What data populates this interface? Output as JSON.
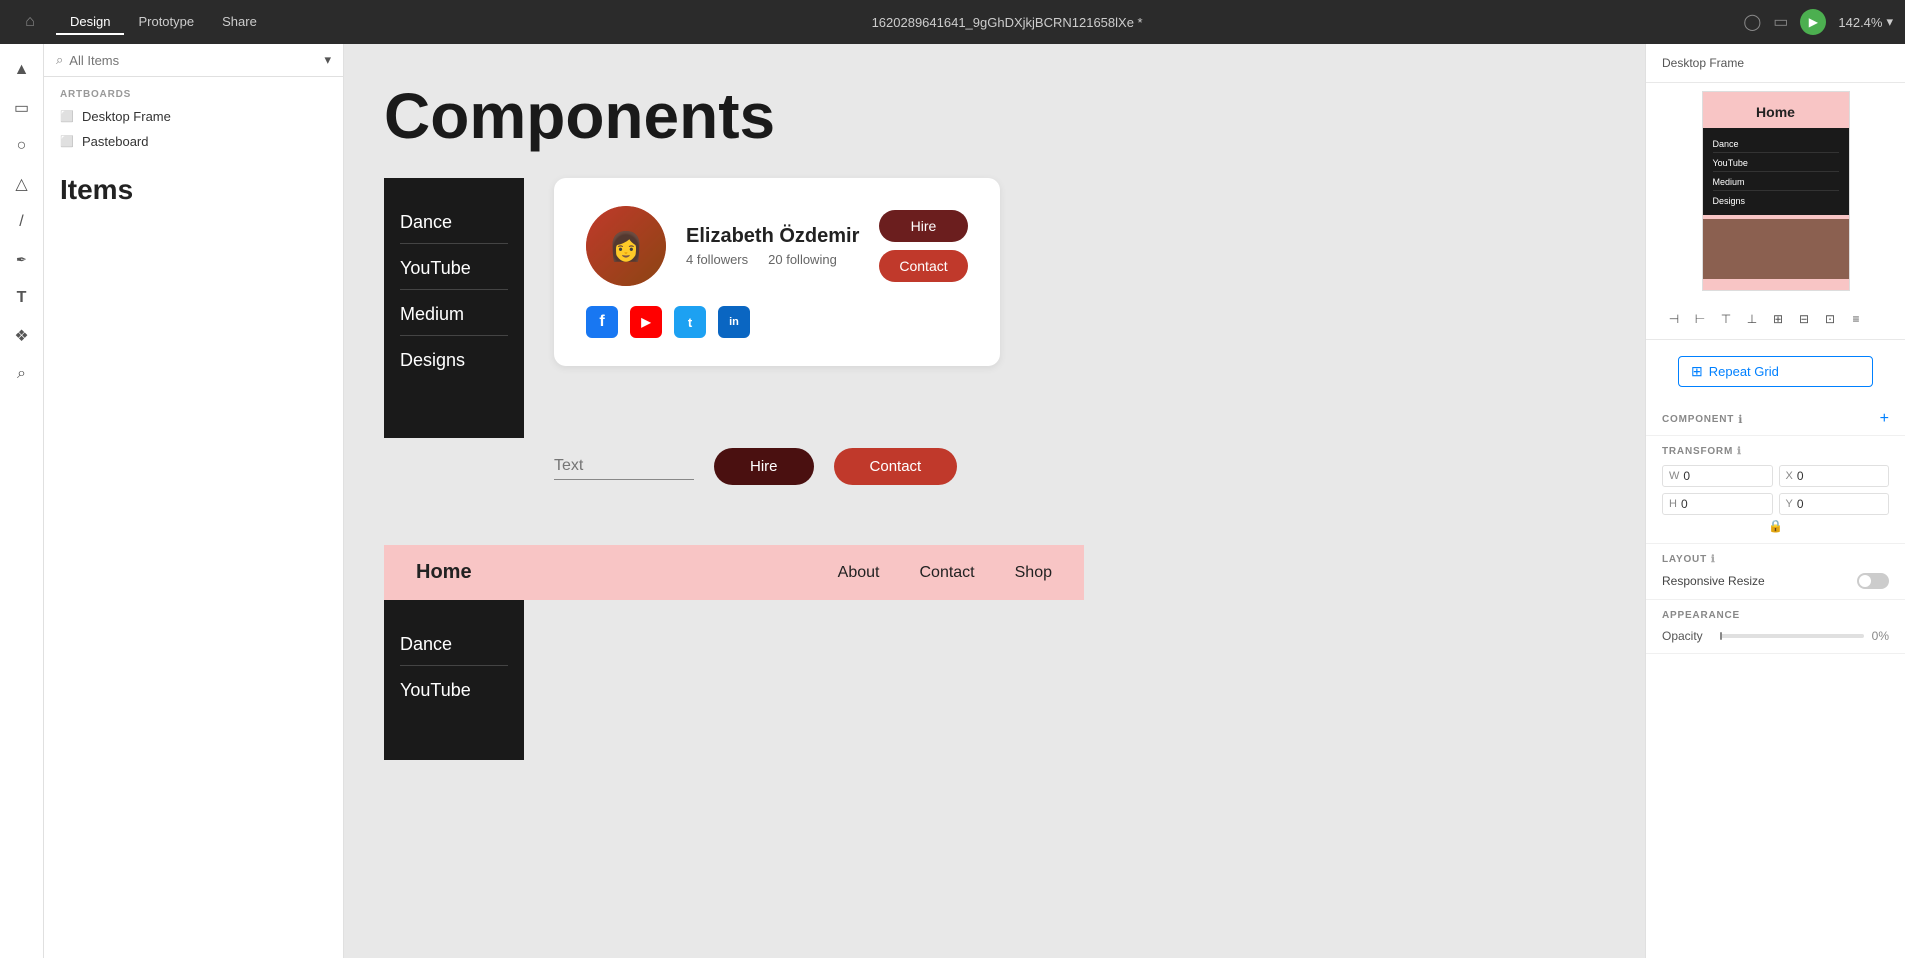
{
  "topbar": {
    "home_icon": "⌂",
    "tabs": [
      "Design",
      "Prototype",
      "Share"
    ],
    "active_tab": "Design",
    "filename": "1620289641641_9gGhDXjkjBCRN121658lXe *",
    "zoom": "142.4%",
    "play_icon": "▶",
    "device_icon": "□",
    "user_icon": "◯"
  },
  "left_panel": {
    "search_placeholder": "All Items",
    "sections": {
      "artboards_label": "ARTBOARDS",
      "items": [
        {
          "label": "Desktop Frame",
          "icon": "⬜"
        },
        {
          "label": "Pasteboard",
          "icon": "⬜"
        }
      ]
    },
    "items_label": "Items"
  },
  "tools": [
    {
      "name": "select",
      "icon": "▲"
    },
    {
      "name": "rectangle",
      "icon": "▭"
    },
    {
      "name": "ellipse",
      "icon": "○"
    },
    {
      "name": "triangle",
      "icon": "△"
    },
    {
      "name": "line",
      "icon": "/"
    },
    {
      "name": "pen",
      "icon": "✒"
    },
    {
      "name": "text",
      "icon": "T"
    },
    {
      "name": "component",
      "icon": "❖"
    },
    {
      "name": "zoom",
      "icon": "⌕"
    }
  ],
  "canvas": {
    "title": "Components",
    "nav_menu": {
      "items": [
        "Dance",
        "YouTube",
        "Medium",
        "Designs"
      ]
    },
    "nav_menu_bottom": {
      "items": [
        "Dance",
        "YouTube"
      ]
    },
    "profile_card": {
      "name": "Elizabeth Özdemir",
      "followers": "4 followers",
      "following": "20 following",
      "btn_hire": "Hire",
      "btn_contact": "Contact",
      "socials": [
        "f",
        "▶",
        "t",
        "in"
      ]
    },
    "standalone": {
      "text_placeholder": "Text",
      "btn_hire": "Hire",
      "btn_contact": "Contact"
    },
    "nav_bar": {
      "home": "Home",
      "links": [
        "About",
        "Contact",
        "Shop"
      ]
    }
  },
  "right_panel": {
    "desktop_frame_label": "Desktop Frame",
    "thumbnail": {
      "home_text": "Home",
      "nav_items": [
        "Dance",
        "YouTube",
        "Medium",
        "Designs"
      ]
    },
    "repeat_grid_label": "Repeat Grid",
    "component_label": "COMPONENT",
    "component_info": "ℹ",
    "transform_label": "TRANSFORM",
    "transform_info": "ℹ",
    "fields": {
      "w_label": "W",
      "w_value": "0",
      "x_label": "X",
      "x_value": "0",
      "h_label": "H",
      "h_value": "0",
      "y_label": "Y",
      "y_value": "0"
    },
    "layout_label": "LAYOUT",
    "layout_info": "ℹ",
    "responsive_resize": "Responsive Resize",
    "appearance_label": "APPEARANCE",
    "opacity_label": "Opacity",
    "opacity_value": "0%"
  }
}
